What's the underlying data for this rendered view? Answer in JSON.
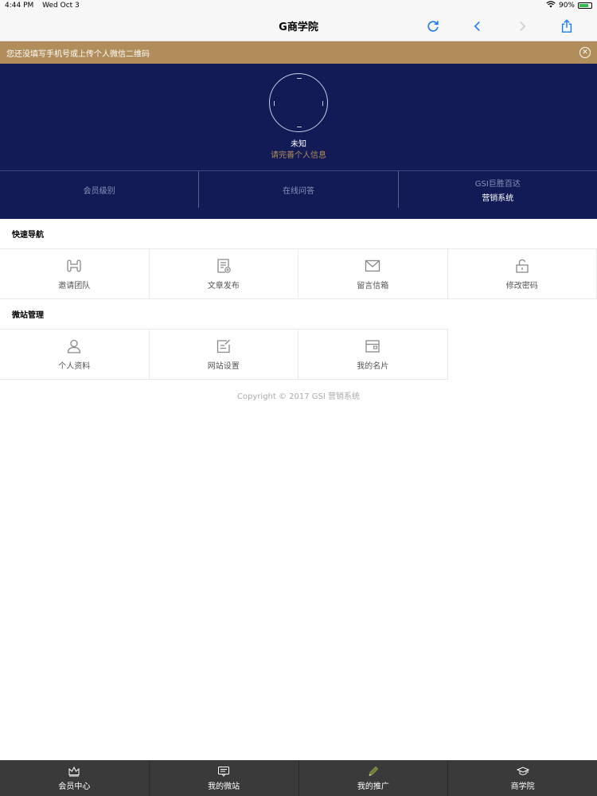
{
  "status_bar": {
    "time": "4:44 PM",
    "date": "Wed Oct 3",
    "battery": "90%"
  },
  "nav": {
    "title": "G商学院"
  },
  "notice": {
    "text": "您还没填写手机号或上传个人微信二维码"
  },
  "profile": {
    "name": "未知",
    "hint": "请完善个人信息",
    "stats": [
      {
        "label": "会员级别",
        "sub": ""
      },
      {
        "label": "在线问答",
        "sub": ""
      },
      {
        "label": "GSI巨胜百达",
        "sub": "营销系统"
      }
    ]
  },
  "quick_nav": {
    "title": "快速导航",
    "items": [
      {
        "label": "邀请团队",
        "icon": "team-icon"
      },
      {
        "label": "文章发布",
        "icon": "article-icon"
      },
      {
        "label": "留言信箱",
        "icon": "mail-icon"
      },
      {
        "label": "修改密码",
        "icon": "lock-icon"
      }
    ]
  },
  "site_manage": {
    "title": "微站管理",
    "items": [
      {
        "label": "个人资料",
        "icon": "user-icon"
      },
      {
        "label": "网站设置",
        "icon": "edit-icon"
      },
      {
        "label": "我的名片",
        "icon": "card-icon"
      }
    ]
  },
  "footer": {
    "copyright": "Copyright © 2017 GSI 营销系统"
  },
  "tabs": [
    {
      "label": "会员中心",
      "icon": "crown-icon"
    },
    {
      "label": "我的微站",
      "icon": "message-icon"
    },
    {
      "label": "我的推广",
      "icon": "pen-icon"
    },
    {
      "label": "商学院",
      "icon": "graduation-cap-icon"
    }
  ],
  "colors": {
    "header_bg": "#121b56",
    "notice_bg": "#b08d5a",
    "tab_bg": "#3a3a3a",
    "accent_blue": "#1a7bf2"
  }
}
